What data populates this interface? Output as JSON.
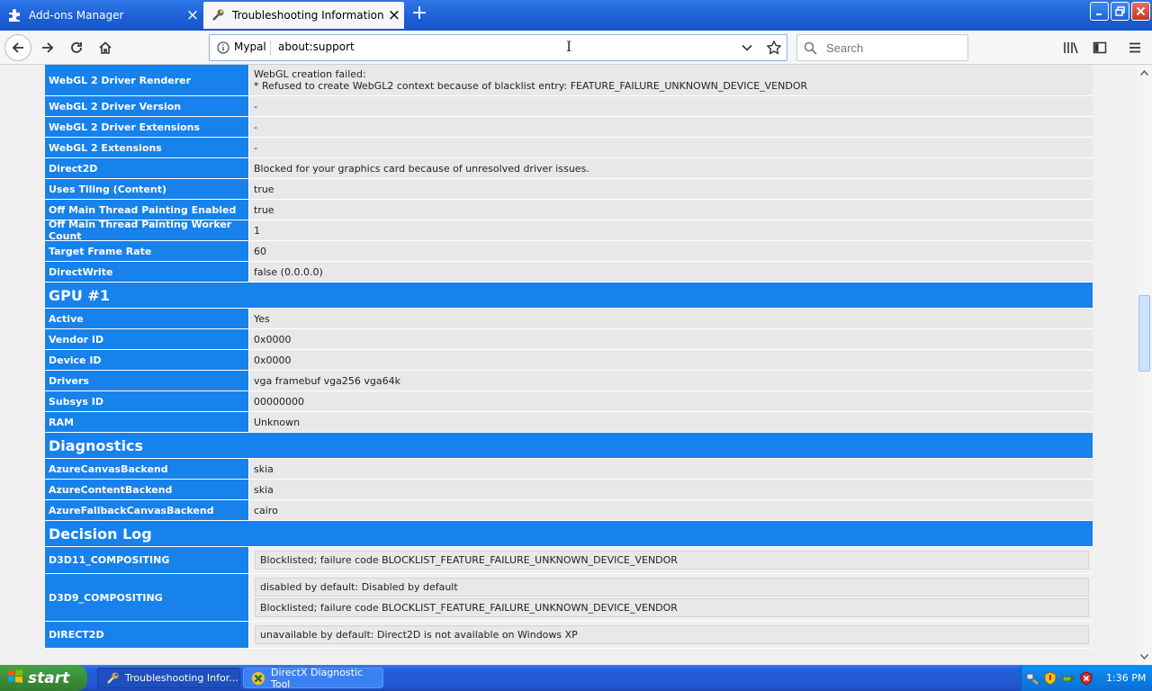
{
  "tabs": [
    {
      "title": "Add-ons Manager",
      "active": false
    },
    {
      "title": "Troubleshooting Information",
      "active": true
    }
  ],
  "urlbar": {
    "site": "Mypal",
    "url": "about:support"
  },
  "search": {
    "placeholder": "Search"
  },
  "graphics_rows": [
    {
      "label": "WebGL 2 Driver Renderer",
      "lines": [
        "WebGL creation failed:",
        "* Refused to create WebGL2 context because of blacklist entry: FEATURE_FAILURE_UNKNOWN_DEVICE_VENDOR"
      ]
    },
    {
      "label": "WebGL 2 Driver Version",
      "value": "-"
    },
    {
      "label": "WebGL 2 Driver Extensions",
      "value": "-"
    },
    {
      "label": "WebGL 2 Extensions",
      "value": "-"
    },
    {
      "label": "Direct2D",
      "value": "Blocked for your graphics card because of unresolved driver issues."
    },
    {
      "label": "Uses Tiling (Content)",
      "value": "true"
    },
    {
      "label": "Off Main Thread Painting Enabled",
      "value": "true"
    },
    {
      "label": "Off Main Thread Painting Worker Count",
      "value": "1"
    },
    {
      "label": "Target Frame Rate",
      "value": "60"
    },
    {
      "label": "DirectWrite",
      "value": "false (0.0.0.0)"
    }
  ],
  "gpu": {
    "title": "GPU #1",
    "rows": [
      {
        "label": "Active",
        "value": "Yes"
      },
      {
        "label": "Vendor ID",
        "value": "0x0000"
      },
      {
        "label": "Device ID",
        "value": "0x0000"
      },
      {
        "label": "Drivers",
        "value": "vga framebuf vga256 vga64k"
      },
      {
        "label": "Subsys ID",
        "value": "00000000"
      },
      {
        "label": "RAM",
        "value": "Unknown"
      }
    ]
  },
  "diagnostics": {
    "title": "Diagnostics",
    "rows": [
      {
        "label": "AzureCanvasBackend",
        "value": "skia"
      },
      {
        "label": "AzureContentBackend",
        "value": "skia"
      },
      {
        "label": "AzureFallbackCanvasBackend",
        "value": "cairo"
      }
    ]
  },
  "decision_log": {
    "title": "Decision Log",
    "rows": [
      {
        "label": "D3D11_COMPOSITING",
        "entries": [
          "Blocklisted; failure code BLOCKLIST_FEATURE_FAILURE_UNKNOWN_DEVICE_VENDOR"
        ]
      },
      {
        "label": "D3D9_COMPOSITING",
        "entries": [
          "disabled by default: Disabled by default",
          "Blocklisted; failure code BLOCKLIST_FEATURE_FAILURE_UNKNOWN_DEVICE_VENDOR"
        ]
      },
      {
        "label": "DIRECT2D",
        "entries": [
          "unavailable by default: Direct2D is not available on Windows XP"
        ]
      }
    ]
  },
  "taskbar": {
    "start_label": "start",
    "tasks": [
      {
        "title": "Troubleshooting Infor...",
        "active": false
      },
      {
        "title": "DirectX Diagnostic Tool",
        "active": true
      }
    ],
    "clock": "1:36 PM"
  },
  "colors": {
    "header_blue": "#1781ec",
    "row_gray": "#e8e8e8",
    "taskbar_blue": "#245edb"
  }
}
